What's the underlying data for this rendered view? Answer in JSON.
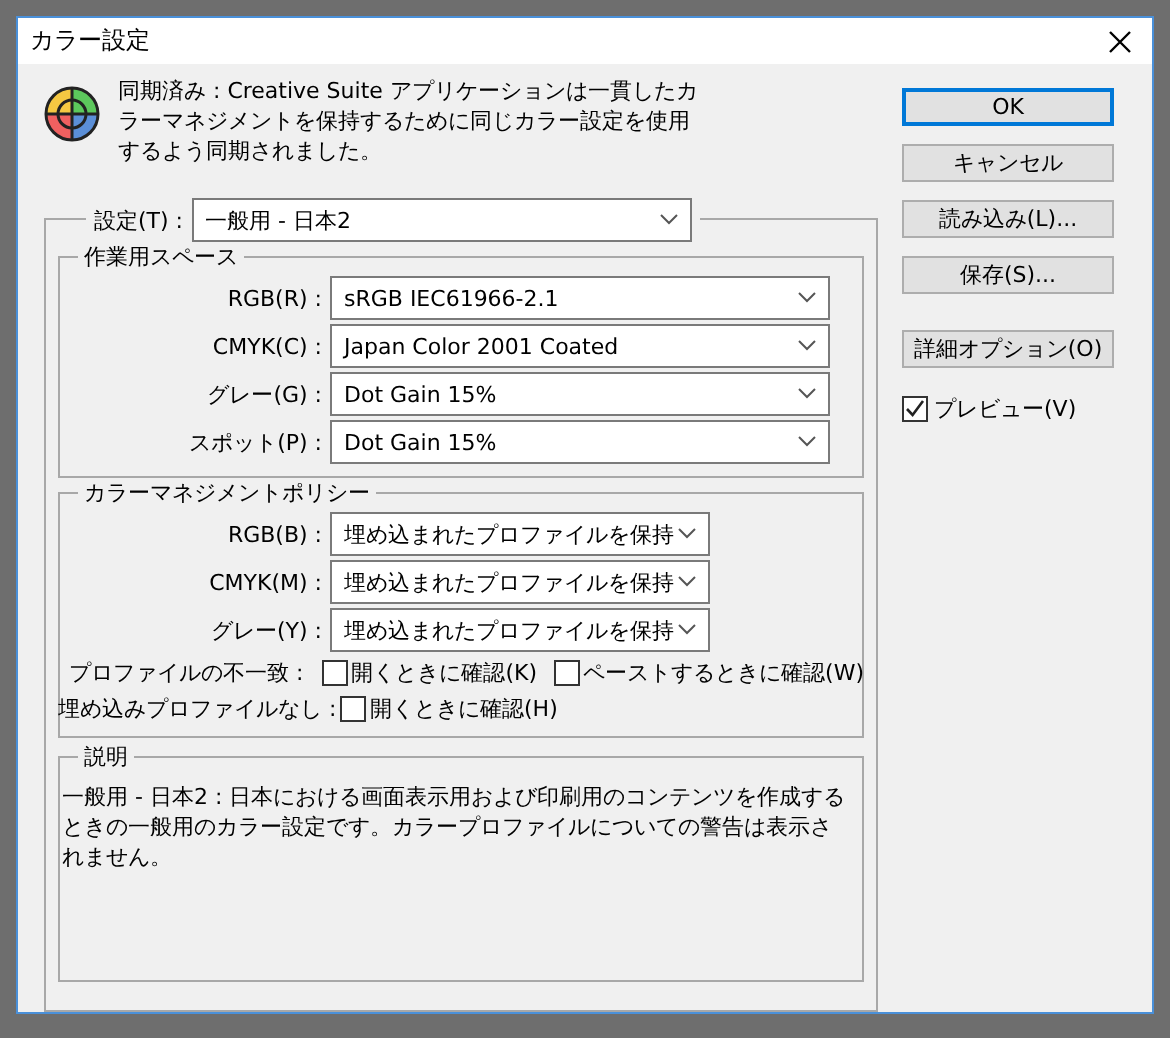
{
  "window": {
    "title": "カラー設定"
  },
  "sync_message": "同期済み : Creative Suite アプリケーションは一貫したカラーマネジメントを保持するために同じカラー設定を使用するよう同期されました。",
  "settings": {
    "label": "設定(T) :",
    "value": "一般用 - 日本2"
  },
  "working_spaces": {
    "title": "作業用スペース",
    "rows": [
      {
        "label": "RGB(R) :",
        "value": "sRGB IEC61966-2.1"
      },
      {
        "label": "CMYK(C) :",
        "value": "Japan Color 2001 Coated"
      },
      {
        "label": "グレー(G) :",
        "value": "Dot Gain 15%"
      },
      {
        "label": "スポット(P) :",
        "value": "Dot Gain 15%"
      }
    ]
  },
  "policies": {
    "title": "カラーマネジメントポリシー",
    "rows": [
      {
        "label": "RGB(B) :",
        "value": "埋め込まれたプロファイルを保持"
      },
      {
        "label": "CMYK(M) :",
        "value": "埋め込まれたプロファイルを保持"
      },
      {
        "label": "グレー(Y) :",
        "value": "埋め込まれたプロファイルを保持"
      }
    ],
    "checks": [
      {
        "label": "プロファイルの不一致 :",
        "options": [
          {
            "label": "開くときに確認(K)",
            "checked": false
          },
          {
            "label": "ペーストするときに確認(W)",
            "checked": false
          }
        ]
      },
      {
        "label": "埋め込みプロファイルなし :",
        "options": [
          {
            "label": "開くときに確認(H)",
            "checked": false
          }
        ]
      }
    ]
  },
  "description": {
    "title": "説明",
    "text": "一般用 - 日本2 : 日本における画面表示用および印刷用のコンテンツを作成するときの一般用のカラー設定です。カラープロファイルについての警告は表示されません。"
  },
  "buttons": [
    {
      "label": "OK",
      "default": true
    },
    {
      "label": "キャンセル",
      "default": false
    },
    {
      "label": "読み込み(L)...",
      "default": false
    },
    {
      "label": "保存(S)...",
      "default": false
    },
    {
      "label": "詳細オプション(O)",
      "default": false,
      "kind": "spaced"
    }
  ],
  "preview": {
    "label": "プレビュー(V)",
    "checked": true
  }
}
